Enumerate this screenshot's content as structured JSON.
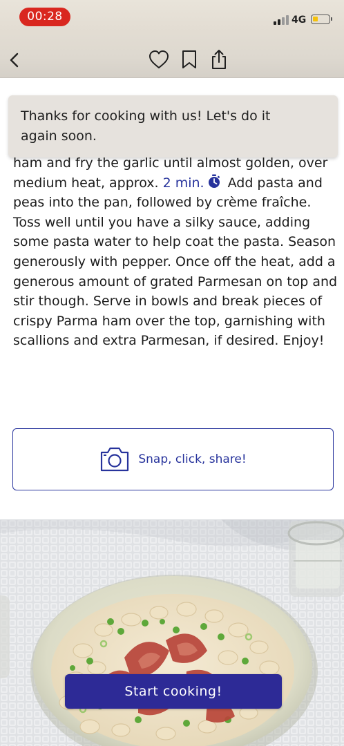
{
  "status_bar": {
    "time": "00:28",
    "network": "4G",
    "battery_level": 0.25,
    "colors": {
      "time_pill": "#d9271f",
      "battery_fill": "#f4c10c"
    }
  },
  "nav": {
    "back_icon": "chevron-left-icon",
    "favorite_icon": "heart-icon",
    "bookmark_icon": "bookmark-icon",
    "share_icon": "share-icon"
  },
  "toast": {
    "message": "Thanks for cooking with us! Let's do it again soon."
  },
  "step": {
    "text_before": "ham and fry the garlic until almost golden, over medium heat, approx.",
    "timer": "2 min.",
    "timer_icon": "stopwatch-icon",
    "text_after": "Add pasta and peas into the pan, followed by crème fraîche. Toss well until you have a silky sauce, adding some pasta water to help coat the pasta. Season generously with pepper. Once off the heat, add a generous amount of grated Parmesan on top and stir though. Serve in bowls and break pieces of crispy Parma ham over the top, garnishing with scallions and extra Parmesan, if desired. Enjoy!"
  },
  "share": {
    "label": "Snap, click, share!",
    "icon": "camera-icon"
  },
  "photo": {
    "description_icon": "recipe-photo"
  },
  "start_button": {
    "label": "Start cooking!"
  },
  "colors": {
    "accent": "#27339c",
    "primary_button": "#2d2a96"
  }
}
